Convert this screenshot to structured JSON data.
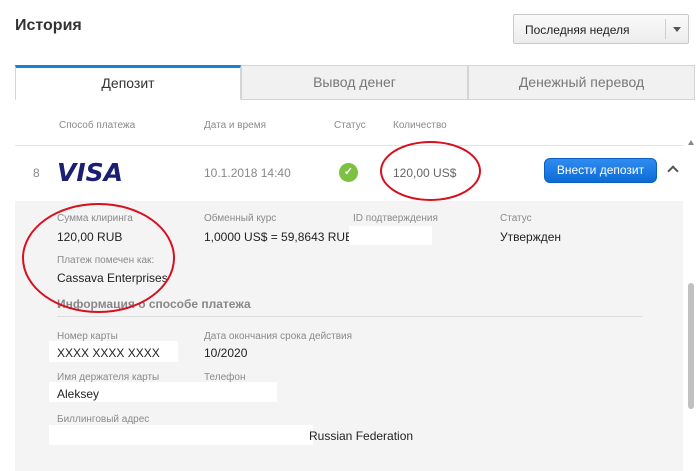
{
  "header": {
    "title": "История",
    "period_select": {
      "selected": "Последняя неделя"
    }
  },
  "tabs": [
    {
      "label": "Депозит",
      "active": true
    },
    {
      "label": "Вывод денег",
      "active": false
    },
    {
      "label": "Денежный перевод",
      "active": false
    }
  ],
  "table": {
    "columns": [
      "Способ платежа",
      "Дата и время",
      "Статус",
      "Количество"
    ],
    "row": {
      "number": "8",
      "method_logo": "VISA",
      "datetime": "10.1.2018 14:40",
      "status_icon": "check-circle-icon",
      "amount": "120,00 US$",
      "action_label": "Внести депозит"
    }
  },
  "details": {
    "clearing_amount": {
      "label": "Сумма клиринга",
      "value": "120,00 RUB"
    },
    "exchange_rate": {
      "label": "Обменный курс",
      "value": "1,0000 US$ = 59,8643 RUB"
    },
    "confirmation_id": {
      "label": "ID подтверждения",
      "value": ""
    },
    "status": {
      "label": "Статус",
      "value": "Утвержден"
    },
    "payment_marked": {
      "label": "Платеж помечен как:",
      "value": "Cassava Enterprises"
    },
    "method_info_title": "Информация о способе платежа",
    "card_number": {
      "label": "Номер карты",
      "value": "XXXX XXXX XXXX"
    },
    "expiry": {
      "label": "Дата окончания срока действия",
      "value": "10/2020"
    },
    "holder": {
      "label": "Имя держателя карты",
      "value": "Aleksey"
    },
    "phone": {
      "label": "Телефон",
      "value": ""
    },
    "billing_address": {
      "label": "Биллинговый адрес",
      "value": "Russian Federation"
    }
  },
  "colors": {
    "accent": "#1b7fd6",
    "button": "#0d6bd6",
    "status_ok": "#7cc142",
    "annotation": "#d6101e",
    "visa": "#1a1f71"
  }
}
